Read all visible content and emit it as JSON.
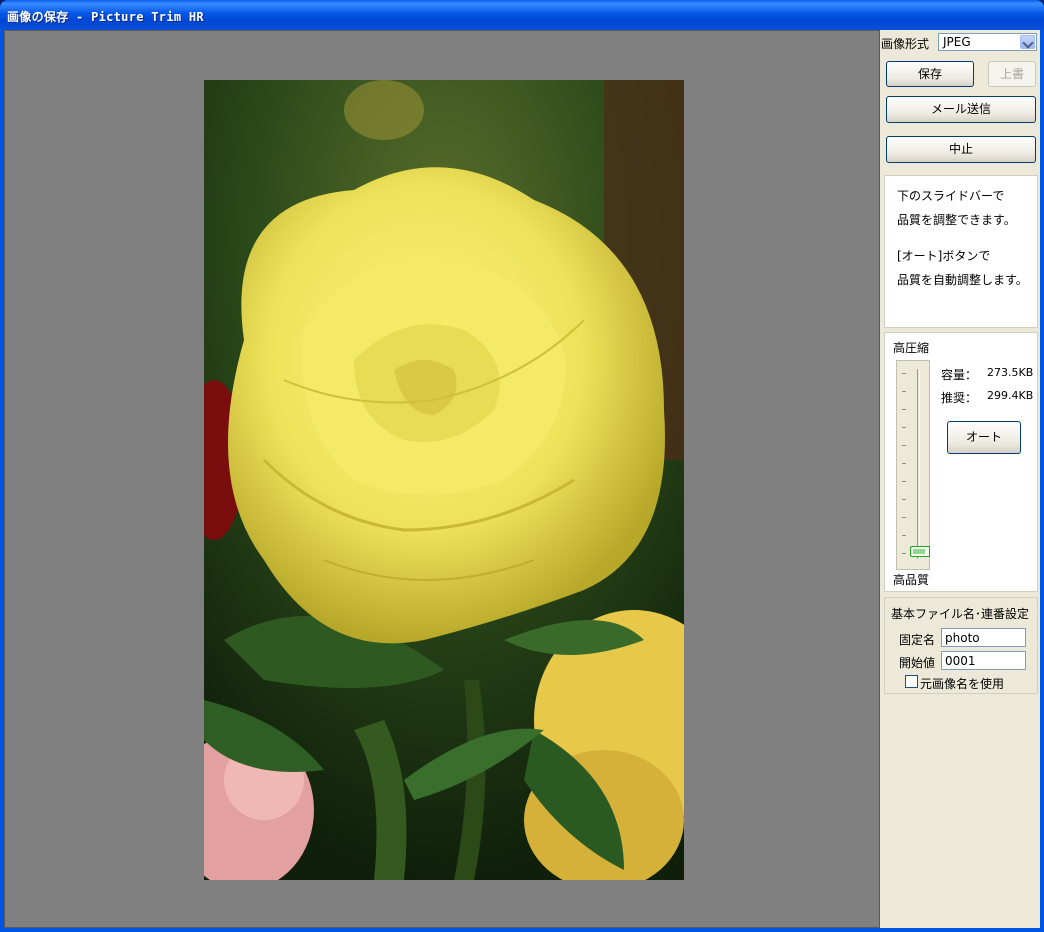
{
  "window": {
    "title": "画像の保存 - Picture Trim HR"
  },
  "format": {
    "label": "画像形式",
    "selected": "JPEG"
  },
  "buttons": {
    "save": "保存",
    "overwrite": "上書",
    "mail": "メール送信",
    "stop": "中止",
    "auto": "オート"
  },
  "help": {
    "line1": "下のスライドバーで",
    "line2": "品質を調整できます。",
    "line3": "[オート]ボタンで",
    "line4": "品質を自動調整します。"
  },
  "quality": {
    "top_label": "高圧縮",
    "bottom_label": "高品質",
    "size_label": "容量：",
    "size_value": "273.5KB",
    "recommend_label": "推奨：",
    "recommend_value": "299.4KB",
    "level": 0.05
  },
  "naming": {
    "header": "基本ファイル名･連番設定",
    "fixed_label": "固定名",
    "fixed_value": "photo",
    "start_label": "開始値",
    "start_value": "0001",
    "use_original_label": "元画像名を使用",
    "use_original_checked": false
  },
  "colors": {
    "title_bar": "#0054e3",
    "panel_bg": "#ece9d8",
    "preview_bg": "#808080",
    "slider_thumb": "#21a121"
  }
}
